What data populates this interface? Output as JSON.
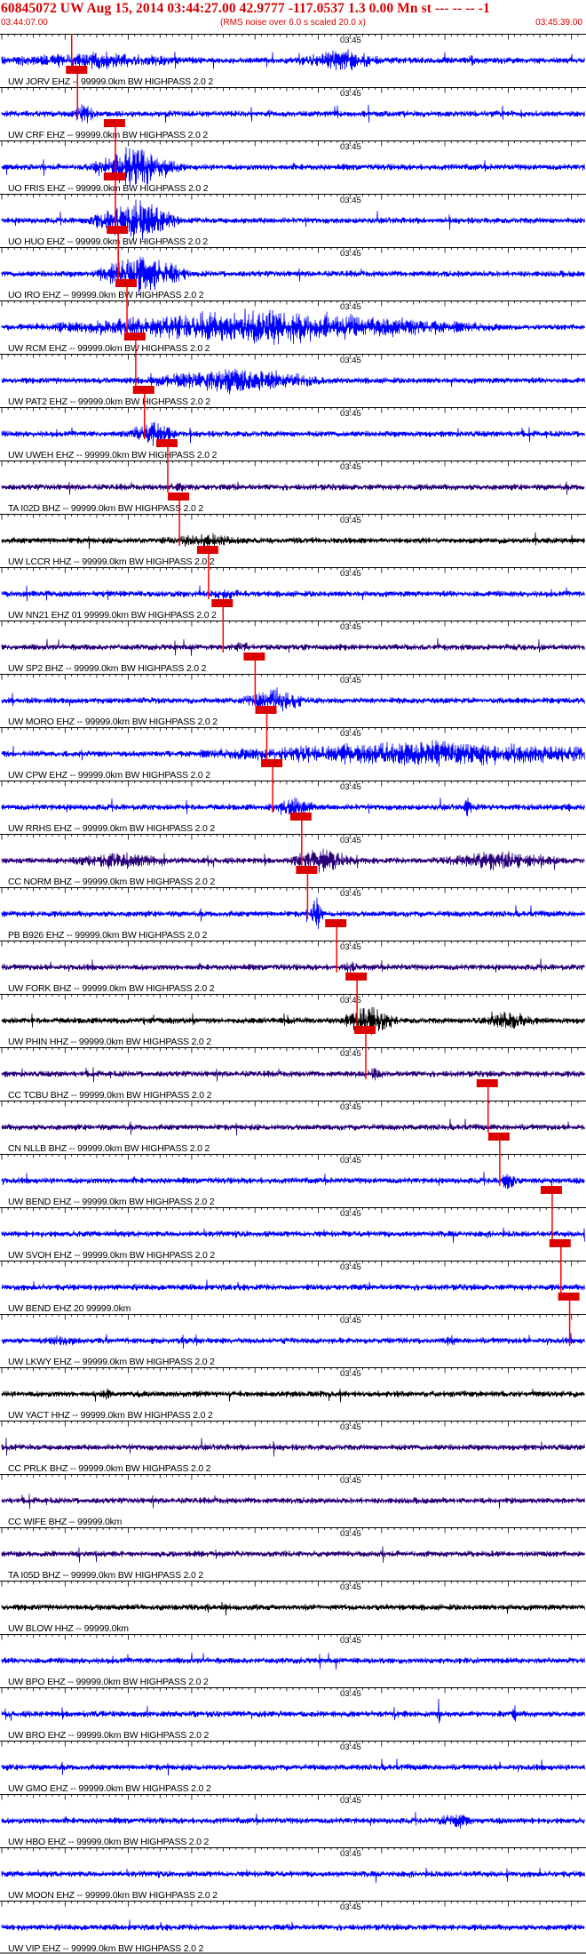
{
  "header": {
    "title": "60845072 UW Aug 15, 2014 03:44:27.00   42.9777 -117.0537  1.3 0.00 Mn st --- -- --   -1",
    "start_time": "03:44:07.00",
    "rms_note": "(RMS noise over 6.0 s scaled 20.0 x)",
    "end_time": "03:45:39.00"
  },
  "colors": {
    "axis": "#000000",
    "pick_line": "#ff0000",
    "pick_box": "#dd0000",
    "blue": "#0000ff",
    "purple": "#2a007a",
    "black": "#000000"
  },
  "chart_data": {
    "type": "line",
    "title": "",
    "xlabel": "",
    "ylabel": "",
    "x_range": [
      "03:44:07.00",
      "03:45:39.00"
    ],
    "minute_marker_label": "03:45",
    "grid": false,
    "series": [
      {
        "label": "UW JORV EHZ -- 99999.0km BW  HIGHPASS  2.0  2",
        "color": "blue",
        "pick": 0.12,
        "env": [
          [
            0.16,
            0.3,
            0.4
          ],
          [
            0.58,
            0.1,
            0.55
          ],
          [
            0.805,
            0.03,
            0.25
          ]
        ]
      },
      {
        "label": "UW CRF EHZ -- 99999.0km BW  HIGHPASS  2.0  2",
        "color": "blue",
        "pick": 0.13,
        "env": [
          [
            0.14,
            0.03,
            0.5
          ]
        ]
      },
      {
        "label": "UO FRIS EHZ -- 99999.0km BW  HIGHPASS  2.0  2",
        "color": "blue",
        "pick": 0.195,
        "env": [
          [
            0.23,
            0.1,
            1.0
          ]
        ]
      },
      {
        "label": "UO HUO EHZ -- 99999.0km BW  HIGHPASS  2.0  2",
        "color": "blue",
        "pick": 0.195,
        "env": [
          [
            0.23,
            0.1,
            1.0
          ]
        ]
      },
      {
        "label": "UO IRO EHZ -- 99999.0km BW  HIGHPASS  2.0  2",
        "color": "blue",
        "pick": 0.2,
        "env": [
          [
            0.24,
            0.1,
            1.0
          ]
        ]
      },
      {
        "label": "UW RCM EHZ -- 99999.0km BW  HIGHPASS  2.0  2",
        "color": "blue",
        "pick": 0.215,
        "env": [
          [
            0.45,
            0.5,
            0.8
          ]
        ]
      },
      {
        "label": "UW PAT2 EHZ -- 99999.0km BW  HIGHPASS  2.0  2",
        "color": "blue",
        "pick": 0.23,
        "env": [
          [
            0.4,
            0.22,
            0.6
          ]
        ]
      },
      {
        "label": "UW UWEH EHZ -- 99999.0km BW  HIGHPASS  2.0  2",
        "color": "blue",
        "pick": 0.245,
        "env": [
          [
            0.26,
            0.06,
            0.6
          ]
        ]
      },
      {
        "label": "TA I02D BHZ -- 99999.0km BW  HIGHPASS  2.0  2",
        "color": "purple",
        "pick": 0.285,
        "env": [
          [
            0.3,
            0.03,
            0.3
          ]
        ]
      },
      {
        "label": "UW LCCR HHZ -- 99999.0km BW  HIGHPASS  2.0  2",
        "color": "black",
        "pick": 0.305,
        "env": [
          [
            0.35,
            0.12,
            0.35
          ]
        ]
      },
      {
        "label": "UW NN21 EHZ 01 99999.0km BW  HIGHPASS  2.0  2",
        "color": "blue",
        "pick": 0.355,
        "env": [
          [
            0.38,
            0.06,
            0.3
          ]
        ]
      },
      {
        "label": "UW SP2 BHZ -- 99999.0km BW  HIGHPASS  2.0  2",
        "color": "purple",
        "pick": 0.38,
        "env": [
          [
            0.41,
            0.06,
            0.25
          ]
        ]
      },
      {
        "label": "UW MORO EHZ -- 99999.0km BW  HIGHPASS  2.0  2",
        "color": "blue",
        "pick": 0.435,
        "env": [
          [
            0.47,
            0.08,
            0.6
          ]
        ]
      },
      {
        "label": "UW CPW EHZ -- 99999.0km BW  HIGHPASS  2.0  2",
        "color": "blue",
        "pick": 0.455,
        "env": [
          [
            0.72,
            0.55,
            0.6
          ]
        ]
      },
      {
        "label": "UW RRHS EHZ -- 99999.0km BW  HIGHPASS  2.0  2",
        "color": "blue",
        "pick": 0.465,
        "env": [
          [
            0.5,
            0.06,
            0.5
          ],
          [
            0.8,
            0.01,
            0.6
          ]
        ]
      },
      {
        "label": "CC NORM BHZ -- 99999.0km BW  HIGHPASS  2.0  2",
        "color": "purple",
        "pick": 0.515,
        "env": [
          [
            0.55,
            0.08,
            0.6
          ],
          [
            0.2,
            0.15,
            0.4
          ],
          [
            0.85,
            0.15,
            0.45
          ]
        ]
      },
      {
        "label": "PB B926 EHZ -- 99999.0km BW  HIGHPASS  2.0  2",
        "color": "blue",
        "pick": 0.525,
        "env": [
          [
            0.54,
            0.015,
            0.8
          ]
        ]
      },
      {
        "label": "UW FORK BHZ -- 99999.0km BW  HIGHPASS  2.0  2",
        "color": "purple",
        "pick": 0.575,
        "env": [
          [
            0.6,
            0.03,
            0.3
          ]
        ]
      },
      {
        "label": "UW PHIN HHZ -- 99999.0km BW  HIGHPASS  2.0  2",
        "color": "black",
        "pick": 0.61,
        "env": [
          [
            0.63,
            0.06,
            0.8
          ],
          [
            0.87,
            0.07,
            0.5
          ]
        ]
      },
      {
        "label": "CC TCBU BHZ -- 99999.0km BW  HIGHPASS  2.0  2",
        "color": "purple",
        "pick": 0.625,
        "env": [
          [
            0.64,
            0.03,
            0.3
          ]
        ]
      },
      {
        "label": "CN NLLB BHZ -- 99999.0km BW  HIGHPASS  2.0  2",
        "color": "purple",
        "pick": 0.835,
        "env": []
      },
      {
        "label": "UW BEND EHZ -- 99999.0km BW  HIGHPASS  2.0  2",
        "color": "blue",
        "pick": 0.855,
        "env": [
          [
            0.87,
            0.02,
            0.5
          ]
        ]
      },
      {
        "label": "UW SVOH EHZ -- 99999.0km BW  HIGHPASS  2.0  2",
        "color": "blue",
        "pick": 0.945,
        "env": []
      },
      {
        "label": "UW BEND EHZ 20 99999.0km",
        "color": "blue",
        "pick": 0.96,
        "env": []
      },
      {
        "label": "UW LKWY EHZ -- 99999.0km BW  HIGHPASS  2.0  2",
        "color": "blue",
        "pick": 0.975,
        "env": [
          [
            0.1,
            0.06,
            0.3
          ],
          [
            0.77,
            0.02,
            0.3
          ]
        ]
      },
      {
        "label": "UW YACT HHZ -- 99999.0km BW  HIGHPASS  2.0  2",
        "color": "black",
        "pick": null,
        "env": [
          [
            0.18,
            0.02,
            0.3
          ]
        ]
      },
      {
        "label": "CC PRLK BHZ -- 99999.0km BW  HIGHPASS  2.0  2",
        "color": "purple",
        "pick": null,
        "env": []
      },
      {
        "label": "CC WIFE BHZ -- 99999.0km",
        "color": "purple",
        "pick": null,
        "env": []
      },
      {
        "label": "TA I05D BHZ -- 99999.0km BW  HIGHPASS  2.0  2",
        "color": "purple",
        "pick": null,
        "env": []
      },
      {
        "label": "UW BLOW HHZ -- 99999.0km",
        "color": "black",
        "pick": null,
        "env": []
      },
      {
        "label": "UW BPO EHZ -- 99999.0km BW  HIGHPASS  2.0  2",
        "color": "blue",
        "pick": null,
        "env": []
      },
      {
        "label": "UW BRO EHZ -- 99999.0km BW  HIGHPASS  2.0  2",
        "color": "blue",
        "pick": null,
        "env": [
          [
            0.75,
            0.005,
            0.8
          ],
          [
            0.88,
            0.005,
            0.7
          ]
        ]
      },
      {
        "label": "UW GMO EHZ -- 99999.0km BW  HIGHPASS  2.0  2",
        "color": "blue",
        "pick": null,
        "env": []
      },
      {
        "label": "UW HBO EHZ -- 99999.0km BW  HIGHPASS  2.0  2",
        "color": "blue",
        "pick": null,
        "env": [
          [
            0.78,
            0.05,
            0.4
          ]
        ]
      },
      {
        "label": "UW MOON EHZ -- 99999.0km BW  HIGHPASS  2.0  2",
        "color": "blue",
        "pick": null,
        "env": []
      },
      {
        "label": "UW VIP EHZ -- 99999.0km BW  HIGHPASS  2.0  2",
        "color": "blue",
        "pick": null,
        "env": []
      }
    ]
  }
}
